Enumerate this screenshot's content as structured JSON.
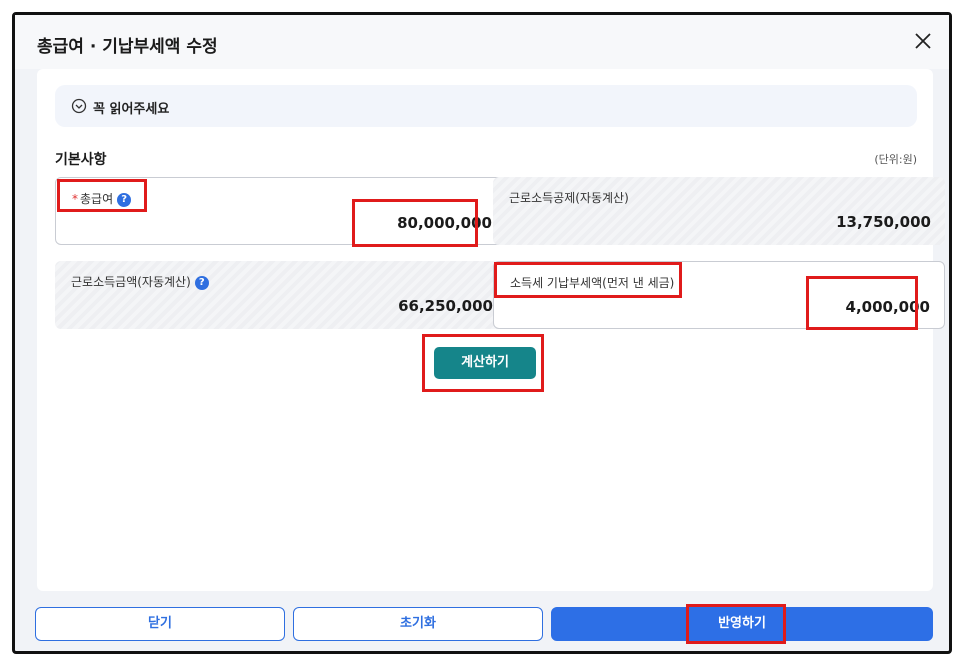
{
  "window": {
    "title": "총급여 · 기납부세액 수정"
  },
  "notice": {
    "label": "꼭 읽어주세요"
  },
  "section": {
    "title": "기본사항",
    "unit": "(단위:원)"
  },
  "fields": {
    "gross_salary": {
      "required_mark": "*",
      "label": "총급여",
      "value": "80,000,000"
    },
    "earned_income_deduction": {
      "label": "근로소득공제(자동계산)",
      "value": "13,750,000"
    },
    "earned_income_amount": {
      "label": "근로소득금액(자동계산)",
      "value": "66,250,000"
    },
    "prepaid_tax": {
      "label": "소득세 기납부세액(먼저 낸 세금)",
      "value": "4,000,000"
    }
  },
  "help_glyph": "?",
  "buttons": {
    "calculate": "계산하기",
    "close": "닫기",
    "reset": "초기화",
    "apply": "반영하기"
  },
  "colors": {
    "primary": "#2d6fe6",
    "calculate": "#15858a",
    "highlight": "#e01b1b",
    "required": "#e03232"
  },
  "icons": {
    "close": "close-icon",
    "notice": "chevron-down-circle-icon",
    "help": "help-icon"
  }
}
